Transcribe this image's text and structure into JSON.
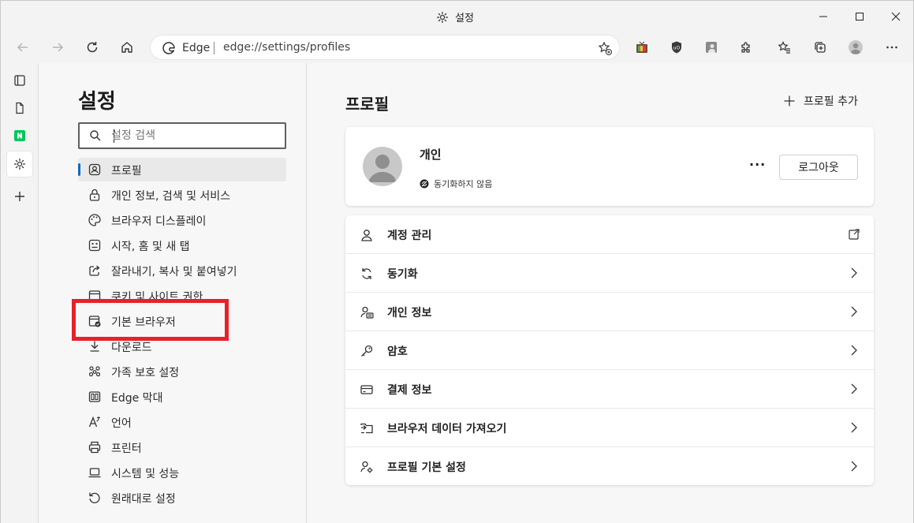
{
  "window": {
    "title": "설정"
  },
  "toolbar": {
    "address_brand": "Edge",
    "address_url": "edge://settings/profiles"
  },
  "nav": {
    "title": "설정",
    "search_placeholder": "설정 검색",
    "items": [
      {
        "label": "프로필",
        "icon": "profile-icon",
        "active": true
      },
      {
        "label": "개인 정보, 검색 및 서비스",
        "icon": "lock-icon"
      },
      {
        "label": "브라우저 디스플레이",
        "icon": "palette-icon"
      },
      {
        "label": "시작, 홈 및 새 탭",
        "icon": "home-grid-icon"
      },
      {
        "label": "잘라내기, 복사 및 붙여넣기",
        "icon": "share-icon"
      },
      {
        "label": "쿠키 및 사이트 권한",
        "icon": "cookie-icon"
      },
      {
        "label": "기본 브라우저",
        "icon": "default-browser-icon"
      },
      {
        "label": "다운로드",
        "icon": "download-icon"
      },
      {
        "label": "가족 보호 설정",
        "icon": "family-icon"
      },
      {
        "label": "Edge 막대",
        "icon": "edge-bar-icon"
      },
      {
        "label": "언어",
        "icon": "language-icon"
      },
      {
        "label": "프린터",
        "icon": "printer-icon"
      },
      {
        "label": "시스템 및 성능",
        "icon": "laptop-icon"
      },
      {
        "label": "원래대로 설정",
        "icon": "reset-icon"
      }
    ]
  },
  "main": {
    "title": "프로필",
    "add_profile": "프로필 추가",
    "profile": {
      "name": "개인",
      "sync_status": "동기화하지 않음",
      "logout_label": "로그아웃",
      "more_label": "···"
    },
    "rows": [
      {
        "label": "계정 관리",
        "icon": "account-icon",
        "action": "external"
      },
      {
        "label": "동기화",
        "icon": "sync-icon",
        "action": "chevron"
      },
      {
        "label": "개인 정보",
        "icon": "personal-info-icon",
        "action": "chevron"
      },
      {
        "label": "암호",
        "icon": "key-icon",
        "action": "chevron"
      },
      {
        "label": "결제 정보",
        "icon": "card-icon",
        "action": "chevron"
      },
      {
        "label": "브라우저 데이터 가져오기",
        "icon": "import-icon",
        "action": "chevron"
      },
      {
        "label": "프로필 기본 설정",
        "icon": "profile-settings-icon",
        "action": "chevron"
      }
    ]
  },
  "colors": {
    "accent": "#0f6cbd",
    "highlight": "#e8202a"
  }
}
